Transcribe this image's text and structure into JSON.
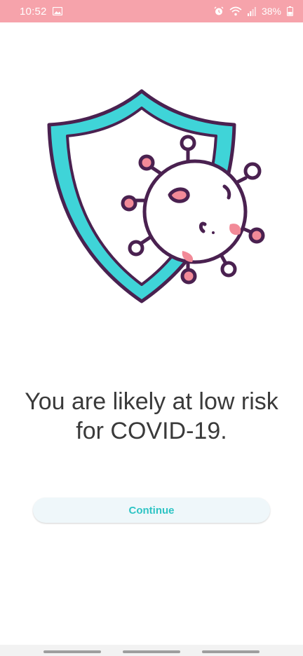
{
  "status_bar": {
    "time": "10:52",
    "battery_percent": "38%",
    "background_color": "#f6a3ab",
    "icons": [
      "gallery-icon",
      "alarm-icon",
      "wifi-icon",
      "signal-icon",
      "battery-icon"
    ]
  },
  "result": {
    "text": "You are likely at low risk for COVID-19."
  },
  "actions": {
    "continue_label": "Continue"
  },
  "colors": {
    "accent": "#2ec4c4",
    "shield": "#3fd4d8",
    "virus_outline": "#4a2150",
    "virus_spots": "#f28a98"
  }
}
